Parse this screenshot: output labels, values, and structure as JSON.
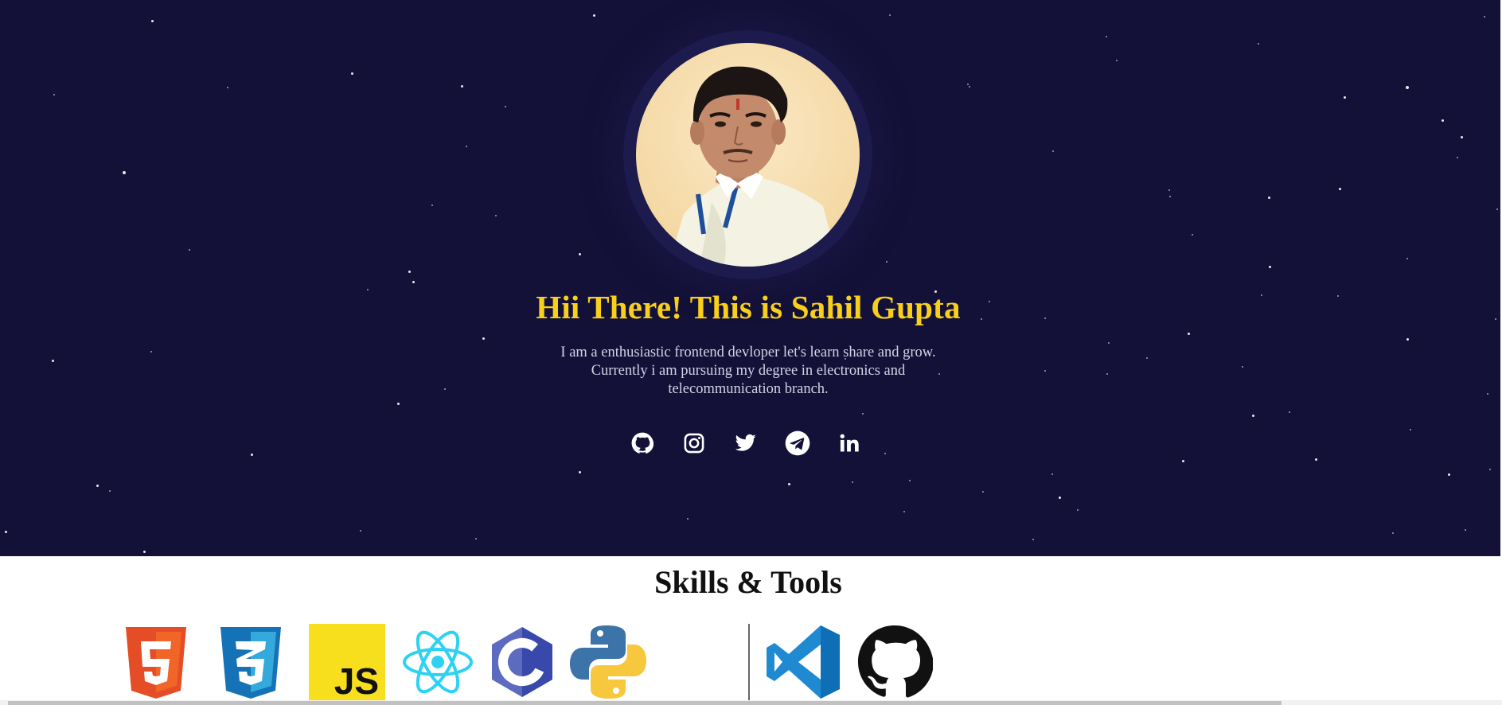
{
  "hero": {
    "title": "Hii There! This is Sahil Gupta",
    "description": "I am a enthusiastic frontend devloper let's learn share and grow. Currently i am pursuing my degree in electronics and telecommunication branch.",
    "title_color": "#f8cf1a",
    "background_color": "#141138"
  },
  "socials": [
    {
      "name": "github-icon"
    },
    {
      "name": "instagram-icon"
    },
    {
      "name": "twitter-icon"
    },
    {
      "name": "telegram-icon"
    },
    {
      "name": "linkedin-icon"
    }
  ],
  "skills": {
    "title": "Skills & Tools",
    "languages": [
      "HTML5",
      "CSS3",
      "JavaScript",
      "React",
      "C",
      "Python"
    ],
    "tools": [
      "Visual Studio Code",
      "GitHub"
    ],
    "js_badge_text": "JS",
    "c_text": "C"
  }
}
